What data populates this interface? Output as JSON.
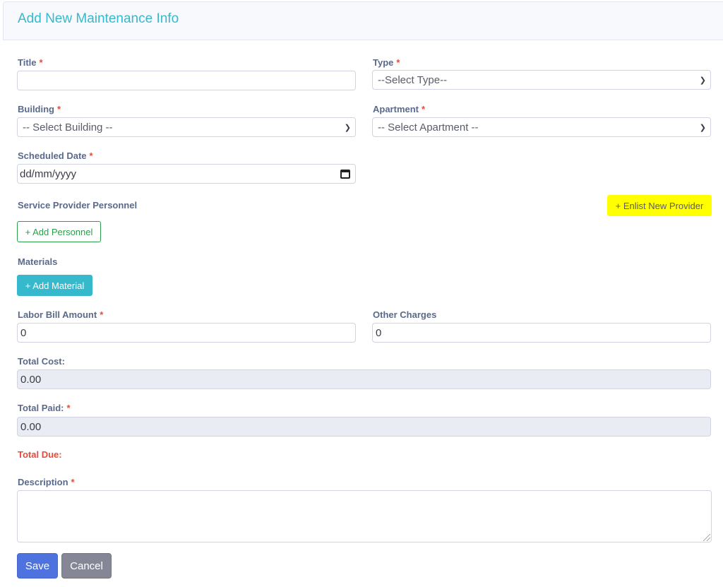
{
  "header": {
    "title": "Add New Maintenance Info"
  },
  "required_mark": "*",
  "form": {
    "title": {
      "label": "Title",
      "value": ""
    },
    "type": {
      "label": "Type",
      "selected": "--Select Type--"
    },
    "building": {
      "label": "Building",
      "selected": "-- Select Building --"
    },
    "apartment": {
      "label": "Apartment",
      "selected": "-- Select Apartment --"
    },
    "scheduled_date": {
      "label": "Scheduled Date",
      "placeholder": "dd/mm/yyyy"
    },
    "service_provider": {
      "label": "Service Provider Personnel",
      "add_personnel_label": "+ Add Personnel",
      "enlist_provider_label": "+ Enlist New Provider"
    },
    "materials": {
      "label": "Materials",
      "add_material_label": "+ Add Material"
    },
    "labor_bill": {
      "label": "Labor Bill Amount",
      "value": "0"
    },
    "other_charges": {
      "label": "Other Charges",
      "value": "0"
    },
    "total_cost": {
      "label": "Total Cost:",
      "value": "0.00"
    },
    "total_paid": {
      "label": "Total Paid:",
      "value": "0.00"
    },
    "total_due": {
      "label": "Total Due:"
    },
    "description": {
      "label": "Description",
      "value": ""
    }
  },
  "actions": {
    "save_label": "Save",
    "cancel_label": "Cancel"
  },
  "colors": {
    "accent": "#36b9cc",
    "required": "#e74a3b",
    "primary": "#4e73df",
    "secondary": "#858796",
    "success": "#2a9d4a",
    "highlight": "#ffff00"
  },
  "icons": {
    "select_arrow": "chevron-down-icon",
    "date_picker": "calendar-icon"
  }
}
